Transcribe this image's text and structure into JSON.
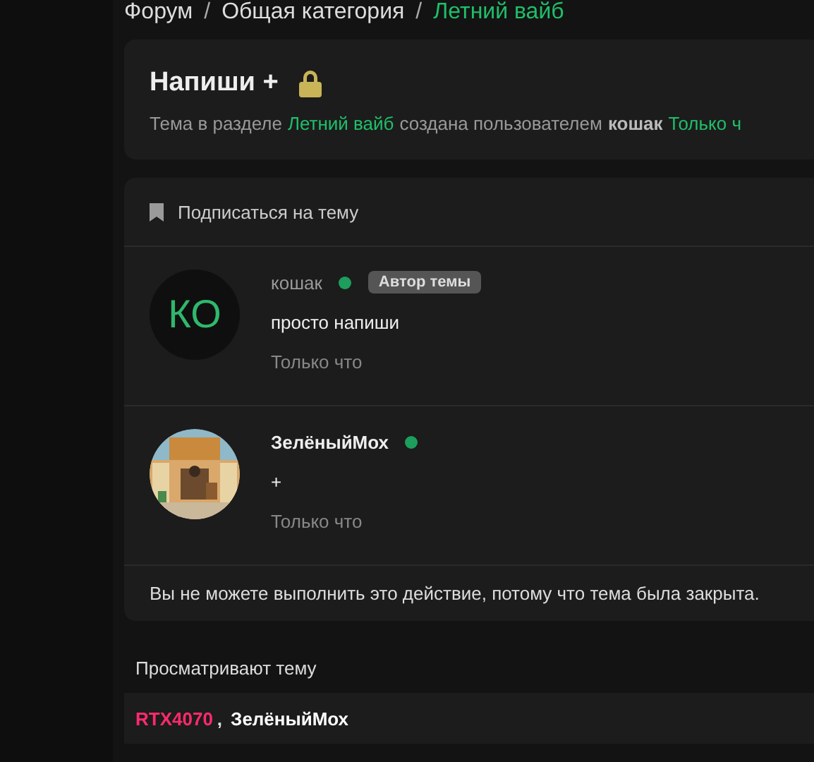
{
  "breadcrumb": [
    {
      "label": "Форум",
      "current": false
    },
    {
      "label": "Общая категория",
      "current": false
    },
    {
      "label": "Летний вайб",
      "current": true
    }
  ],
  "breadcrumb_separator": "/",
  "thread": {
    "title": "Напиши +",
    "locked": true,
    "meta": {
      "prefix": "Тема в разделе",
      "section": "Летний вайб",
      "middle": "создана пользователем",
      "author": "кошак",
      "time": "Только ч"
    }
  },
  "subscribe": "Подписаться на тему",
  "posts": [
    {
      "avatar": {
        "kind": "initials",
        "text": "КО"
      },
      "author": "кошак",
      "online": true,
      "badge": "Автор темы",
      "body": "просто напиши",
      "time": "Только что"
    },
    {
      "author": "ЗелёныйМох",
      "online": true,
      "body": "+",
      "time": "Только что"
    }
  ],
  "notice": "Вы не можете выполнить это действие, потому что тема была закрыта.",
  "viewers": {
    "title": "Просматривают тему",
    "separator": ",",
    "users": [
      {
        "name": "RTX4070",
        "color": "#ff2a6d"
      },
      {
        "name": "ЗелёныйМох",
        "color": "#ffffff"
      }
    ]
  }
}
